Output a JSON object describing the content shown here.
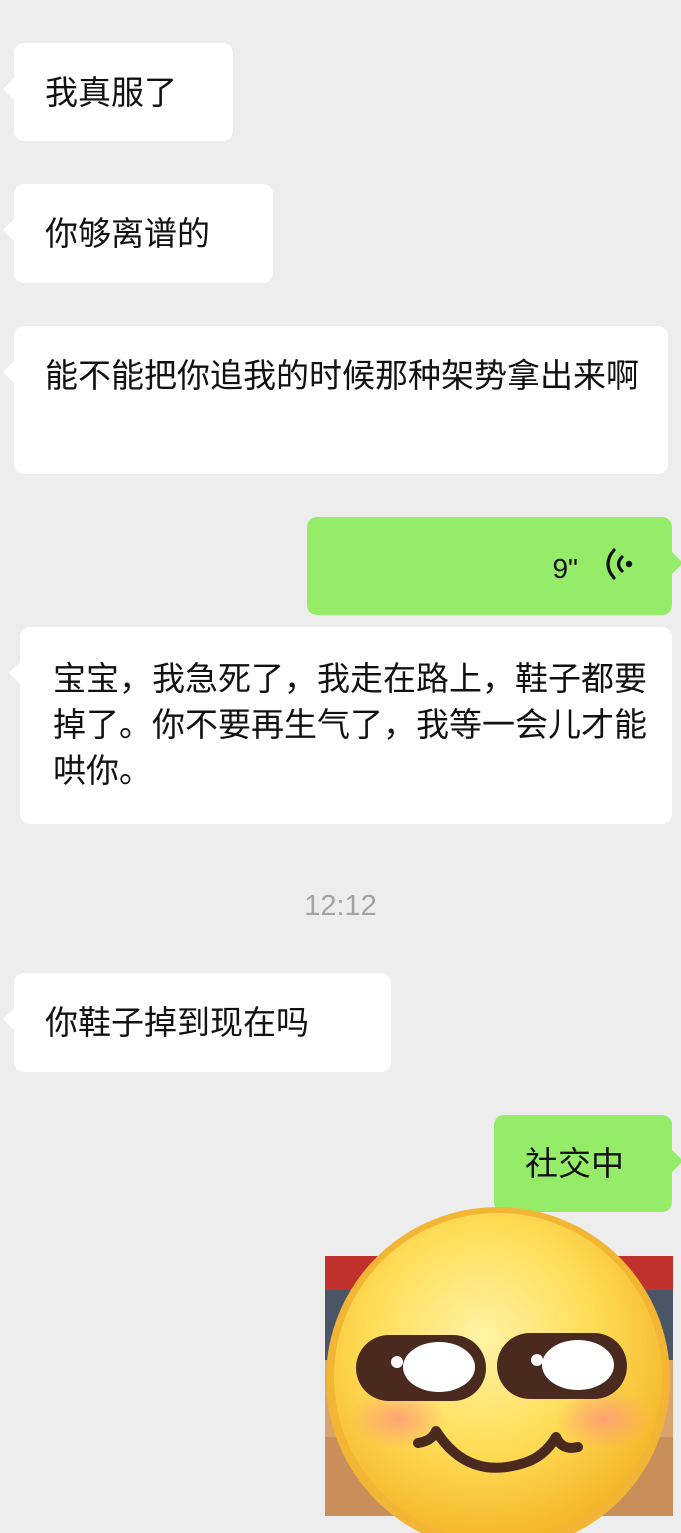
{
  "messages": [
    {
      "text": "我真服了"
    },
    {
      "text": "你够离谱的"
    },
    {
      "text": "能不能把你追我的时候那种架势拿出来啊"
    },
    {
      "duration": "9\""
    },
    {
      "text": "宝宝，我急死了，我走在路上，鞋子都要掉了。你不要再生气了，我等一会儿才能哄你。"
    },
    {
      "text": "你鞋子掉到现在吗"
    },
    {
      "text": "社交中"
    }
  ],
  "timestamp": "12:12",
  "sticker": {
    "icon": "smirk-emoji-sticker"
  },
  "colors": {
    "background": "#ededed",
    "incoming_bubble": "#ffffff",
    "outgoing_bubble": "#95ec69",
    "timestamp": "#a3a3a3"
  }
}
